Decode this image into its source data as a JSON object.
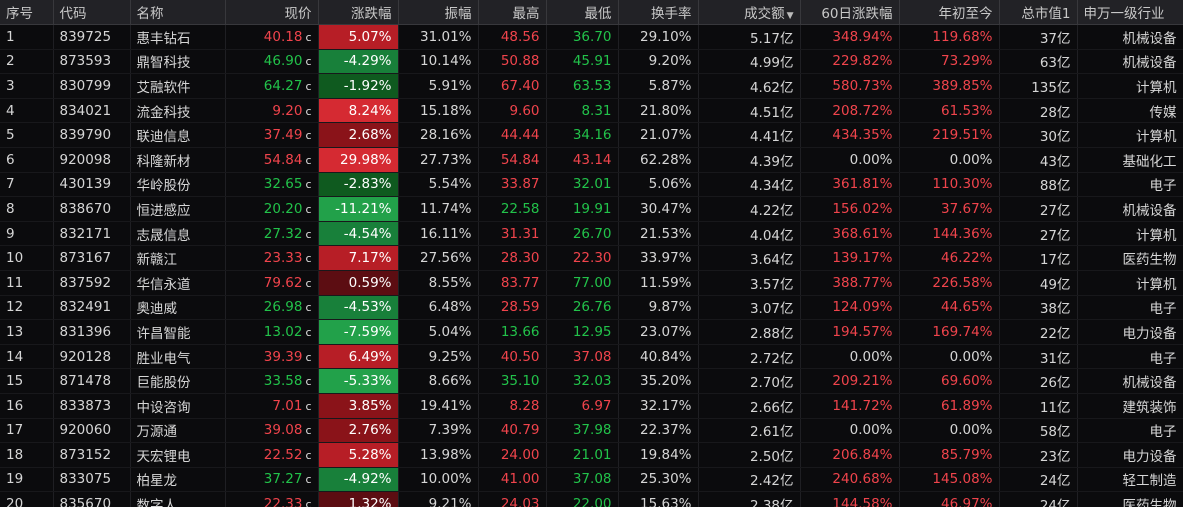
{
  "headers": [
    "序号",
    "代码",
    "名称",
    "现价",
    "涨跌幅",
    "振幅",
    "最高",
    "最低",
    "换手率",
    "成交额",
    "60日涨跌幅",
    "年初至今",
    "总市值1",
    "申万一级行业"
  ],
  "sort_indicator": "▼",
  "price_suffix": "c",
  "rows": [
    {
      "idx": "1",
      "code": "839725",
      "name": "惠丰钻石",
      "price": "40.18",
      "chg": "5.07%",
      "amp": "31.01%",
      "high": "48.56",
      "low": "36.70",
      "turnover": "29.10%",
      "volume": "5.17亿",
      "d60": "348.94%",
      "ytd": "119.68%",
      "mcap": "37亿",
      "industry": "机械设备"
    },
    {
      "idx": "2",
      "code": "873593",
      "name": "鼎智科技",
      "price": "46.90",
      "chg": "-4.29%",
      "amp": "10.14%",
      "high": "50.88",
      "low": "45.91",
      "turnover": "9.20%",
      "volume": "4.99亿",
      "d60": "229.82%",
      "ytd": "73.29%",
      "mcap": "63亿",
      "industry": "机械设备"
    },
    {
      "idx": "3",
      "code": "830799",
      "name": "艾融软件",
      "price": "64.27",
      "chg": "-1.92%",
      "amp": "5.91%",
      "high": "67.40",
      "low": "63.53",
      "turnover": "5.87%",
      "volume": "4.62亿",
      "d60": "580.73%",
      "ytd": "389.85%",
      "mcap": "135亿",
      "industry": "计算机"
    },
    {
      "idx": "4",
      "code": "834021",
      "name": "流金科技",
      "price": "9.20",
      "chg": "8.24%",
      "amp": "15.18%",
      "high": "9.60",
      "low": "8.31",
      "turnover": "21.80%",
      "volume": "4.51亿",
      "d60": "208.72%",
      "ytd": "61.53%",
      "mcap": "28亿",
      "industry": "传媒"
    },
    {
      "idx": "5",
      "code": "839790",
      "name": "联迪信息",
      "price": "37.49",
      "chg": "2.68%",
      "amp": "28.16%",
      "high": "44.44",
      "low": "34.16",
      "turnover": "21.07%",
      "volume": "4.41亿",
      "d60": "434.35%",
      "ytd": "219.51%",
      "mcap": "30亿",
      "industry": "计算机"
    },
    {
      "idx": "6",
      "code": "920098",
      "name": "科隆新材",
      "price": "54.84",
      "chg": "29.98%",
      "amp": "27.73%",
      "high": "54.84",
      "low": "43.14",
      "turnover": "62.28%",
      "volume": "4.39亿",
      "d60": "0.00%",
      "ytd": "0.00%",
      "mcap": "43亿",
      "industry": "基础化工"
    },
    {
      "idx": "7",
      "code": "430139",
      "name": "华岭股份",
      "price": "32.65",
      "chg": "-2.83%",
      "amp": "5.54%",
      "high": "33.87",
      "low": "32.01",
      "turnover": "5.06%",
      "volume": "4.34亿",
      "d60": "361.81%",
      "ytd": "110.30%",
      "mcap": "88亿",
      "industry": "电子"
    },
    {
      "idx": "8",
      "code": "838670",
      "name": "恒进感应",
      "price": "20.20",
      "chg": "-11.21%",
      "amp": "11.74%",
      "high": "22.58",
      "low": "19.91",
      "turnover": "30.47%",
      "volume": "4.22亿",
      "d60": "156.02%",
      "ytd": "37.67%",
      "mcap": "27亿",
      "industry": "机械设备"
    },
    {
      "idx": "9",
      "code": "832171",
      "name": "志晟信息",
      "price": "27.32",
      "chg": "-4.54%",
      "amp": "16.11%",
      "high": "31.31",
      "low": "26.70",
      "turnover": "21.53%",
      "volume": "4.04亿",
      "d60": "368.61%",
      "ytd": "144.36%",
      "mcap": "27亿",
      "industry": "计算机"
    },
    {
      "idx": "10",
      "code": "873167",
      "name": "新赣江",
      "price": "23.33",
      "chg": "7.17%",
      "amp": "27.56%",
      "high": "28.30",
      "low": "22.30",
      "turnover": "33.97%",
      "volume": "3.64亿",
      "d60": "139.17%",
      "ytd": "46.22%",
      "mcap": "17亿",
      "industry": "医药生物"
    },
    {
      "idx": "11",
      "code": "837592",
      "name": "华信永道",
      "price": "79.62",
      "chg": "0.59%",
      "amp": "8.55%",
      "high": "83.77",
      "low": "77.00",
      "turnover": "11.59%",
      "volume": "3.57亿",
      "d60": "388.77%",
      "ytd": "226.58%",
      "mcap": "49亿",
      "industry": "计算机"
    },
    {
      "idx": "12",
      "code": "832491",
      "name": "奥迪威",
      "price": "26.98",
      "chg": "-4.53%",
      "amp": "6.48%",
      "high": "28.59",
      "low": "26.76",
      "turnover": "9.87%",
      "volume": "3.07亿",
      "d60": "124.09%",
      "ytd": "44.65%",
      "mcap": "38亿",
      "industry": "电子"
    },
    {
      "idx": "13",
      "code": "831396",
      "name": "许昌智能",
      "price": "13.02",
      "chg": "-7.59%",
      "amp": "5.04%",
      "high": "13.66",
      "low": "12.95",
      "turnover": "23.07%",
      "volume": "2.88亿",
      "d60": "194.57%",
      "ytd": "169.74%",
      "mcap": "22亿",
      "industry": "电力设备"
    },
    {
      "idx": "14",
      "code": "920128",
      "name": "胜业电气",
      "price": "39.39",
      "chg": "6.49%",
      "amp": "9.25%",
      "high": "40.50",
      "low": "37.08",
      "turnover": "40.84%",
      "volume": "2.72亿",
      "d60": "0.00%",
      "ytd": "0.00%",
      "mcap": "31亿",
      "industry": "电子"
    },
    {
      "idx": "15",
      "code": "871478",
      "name": "巨能股份",
      "price": "33.58",
      "chg": "-5.33%",
      "amp": "8.66%",
      "high": "35.10",
      "low": "32.03",
      "turnover": "35.20%",
      "volume": "2.70亿",
      "d60": "209.21%",
      "ytd": "69.60%",
      "mcap": "26亿",
      "industry": "机械设备"
    },
    {
      "idx": "16",
      "code": "833873",
      "name": "中设咨询",
      "price": "7.01",
      "chg": "3.85%",
      "amp": "19.41%",
      "high": "8.28",
      "low": "6.97",
      "turnover": "32.17%",
      "volume": "2.66亿",
      "d60": "141.72%",
      "ytd": "61.89%",
      "mcap": "11亿",
      "industry": "建筑装饰"
    },
    {
      "idx": "17",
      "code": "920060",
      "name": "万源通",
      "price": "39.08",
      "chg": "2.76%",
      "amp": "7.39%",
      "high": "40.79",
      "low": "37.98",
      "turnover": "22.37%",
      "volume": "2.61亿",
      "d60": "0.00%",
      "ytd": "0.00%",
      "mcap": "58亿",
      "industry": "电子"
    },
    {
      "idx": "18",
      "code": "873152",
      "name": "天宏锂电",
      "price": "22.52",
      "chg": "5.28%",
      "amp": "13.98%",
      "high": "24.00",
      "low": "21.01",
      "turnover": "19.84%",
      "volume": "2.50亿",
      "d60": "206.84%",
      "ytd": "85.79%",
      "mcap": "23亿",
      "industry": "电力设备"
    },
    {
      "idx": "19",
      "code": "833075",
      "name": "柏星龙",
      "price": "37.27",
      "chg": "-4.92%",
      "amp": "10.00%",
      "high": "41.00",
      "low": "37.08",
      "turnover": "25.30%",
      "volume": "2.42亿",
      "d60": "240.68%",
      "ytd": "145.08%",
      "mcap": "24亿",
      "industry": "轻工制造"
    },
    {
      "idx": "20",
      "code": "835670",
      "name": "数字人",
      "price": "22.33",
      "chg": "1.32%",
      "amp": "9.21%",
      "high": "24.03",
      "low": "22.00",
      "turnover": "15.63%",
      "volume": "2.38亿",
      "d60": "144.58%",
      "ytd": "46.97%",
      "mcap": "24亿",
      "industry": "医药生物"
    }
  ]
}
